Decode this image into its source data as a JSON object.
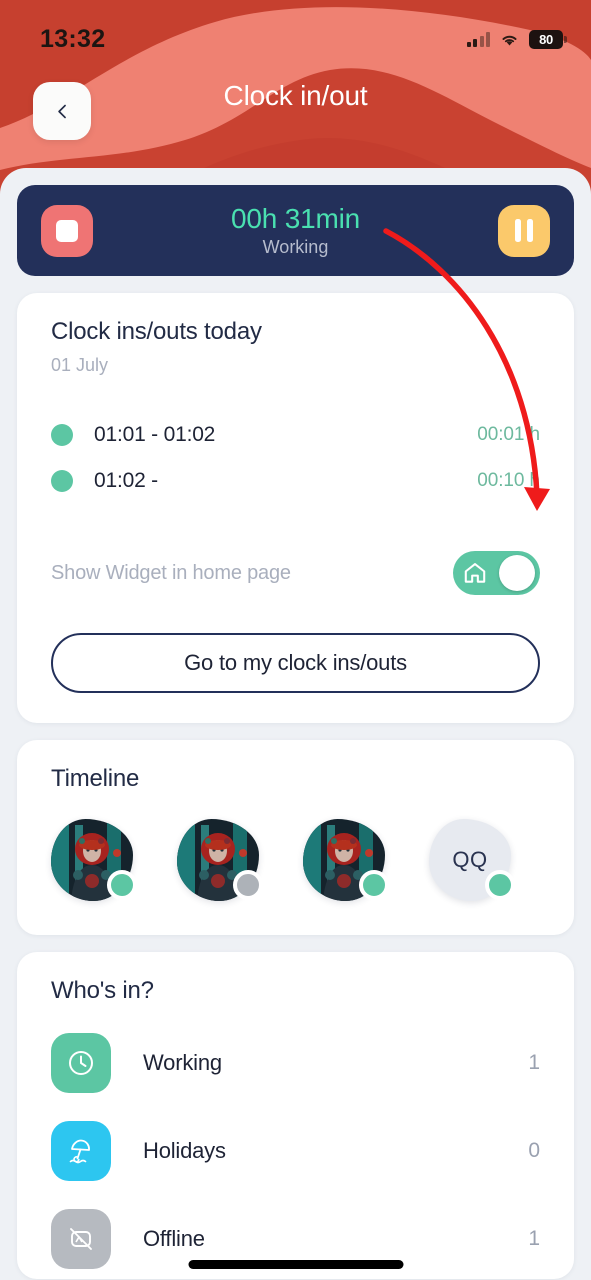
{
  "status_bar": {
    "time": "13:32",
    "battery_level": "80",
    "signal_icon": "signal-bars-icon",
    "wifi_icon": "wifi-icon",
    "battery_icon": "battery-icon"
  },
  "header": {
    "title": "Clock in/out",
    "back_icon": "chevron-left-icon",
    "bg_color": "#c6402f",
    "bg_accent_color": "#ef8172"
  },
  "timer": {
    "value": "00h 31min",
    "status": "Working",
    "stop_icon": "stop-icon",
    "pause_icon": "pause-icon",
    "card_color": "#23305a",
    "value_color": "#4ae0b0",
    "stop_color": "#ef7474",
    "pause_color": "#fbc96b"
  },
  "clock_ins": {
    "title": "Clock ins/outs today",
    "date": "01 July",
    "entries": [
      {
        "range": "01:01 - 01:02",
        "duration": "00:01 h",
        "dot_color": "#5cc6a3"
      },
      {
        "range": "01:02 -",
        "duration": "00:10 h",
        "dot_color": "#5cc6a3"
      }
    ],
    "widget_label": "Show Widget in home page",
    "widget_toggle_on": true,
    "widget_toggle_icon": "home-icon",
    "go_button_label": "Go to my clock ins/outs"
  },
  "timeline": {
    "title": "Timeline",
    "avatars": [
      {
        "type": "photo",
        "initials": "",
        "status_color": "#5cc6a3",
        "name": "avatar-1"
      },
      {
        "type": "photo",
        "initials": "",
        "status_color": "#adb2b8",
        "name": "avatar-2"
      },
      {
        "type": "photo",
        "initials": "",
        "status_color": "#5cc6a3",
        "name": "avatar-3"
      },
      {
        "type": "initials",
        "initials": "QQ",
        "status_color": "#5cc6a3",
        "name": "avatar-4"
      }
    ]
  },
  "whos_in": {
    "title": "Who's in?",
    "rows": [
      {
        "label": "Working",
        "count": "1",
        "icon": "clock-icon",
        "icon_bg": "#5cc6a3"
      },
      {
        "label": "Holidays",
        "count": "0",
        "icon": "beach-umbrella-icon",
        "icon_bg": "#2dc6f0"
      },
      {
        "label": "Offline",
        "count": "1",
        "icon": "offline-icon",
        "icon_bg": "#b6bac0"
      }
    ]
  },
  "annotation": {
    "arrow_color": "#ef1b1b",
    "points_to": "00:10 h"
  }
}
